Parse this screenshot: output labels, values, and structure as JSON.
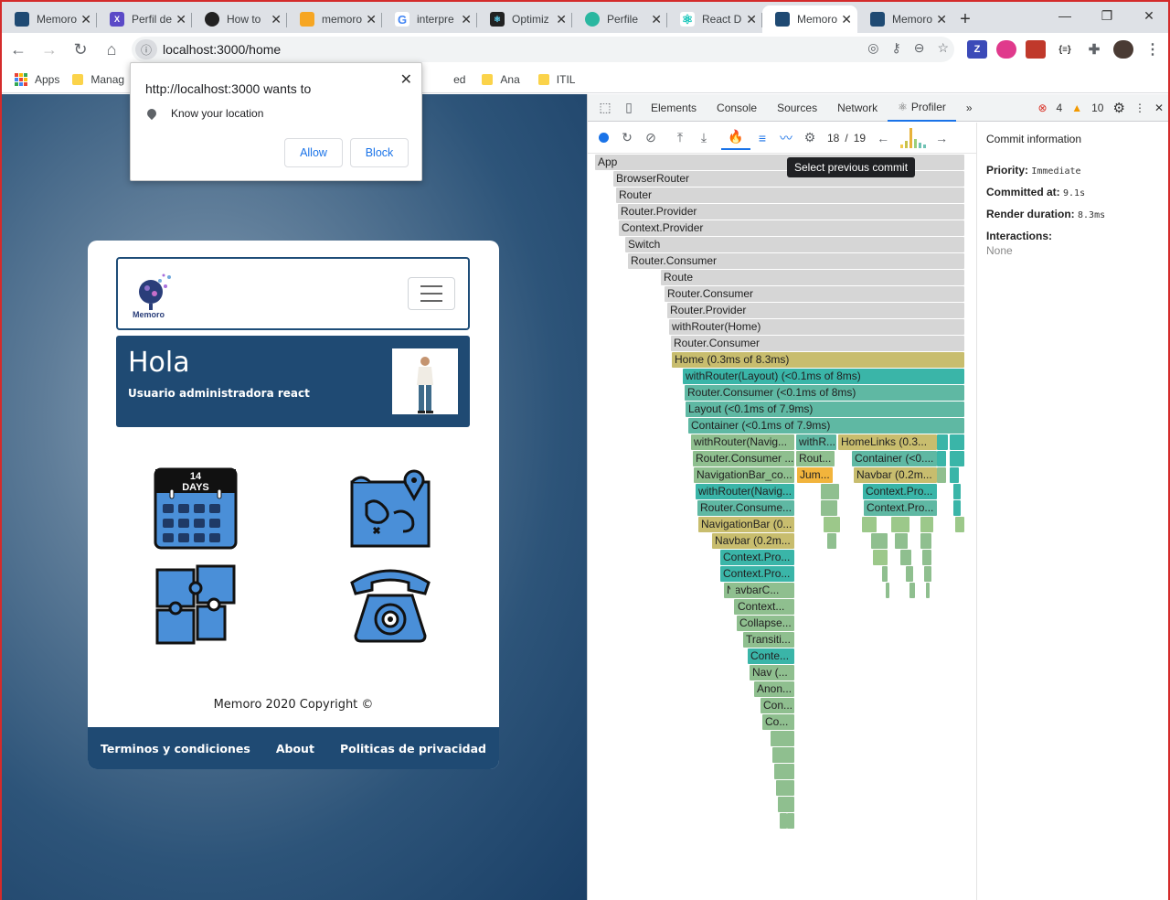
{
  "tabs": [
    {
      "title": "Memoro",
      "favicon": "memoro-icon",
      "color": "#1f4a73"
    },
    {
      "title": "Perfil de",
      "favicon": "xcd-icon",
      "color": "#5b4ac7"
    },
    {
      "title": "How to",
      "favicon": "github-icon",
      "color": "#222"
    },
    {
      "title": "memoro",
      "favicon": "firebase-icon",
      "color": "#f6a623"
    },
    {
      "title": "interpre",
      "favicon": "google-icon",
      "color": "#4285f4"
    },
    {
      "title": "Optimiz",
      "favicon": "react-icon",
      "color": "#222"
    },
    {
      "title": "Perfile",
      "favicon": "edge-icon",
      "color": "#2ab7a0"
    },
    {
      "title": "React D",
      "favicon": "react-icon",
      "color": "#11c4b8"
    },
    {
      "title": "Memoro",
      "favicon": "memoro-icon",
      "color": "#1f4a73",
      "active": true
    },
    {
      "title": "Memoro",
      "favicon": "memoro-icon",
      "color": "#1f4a73"
    }
  ],
  "address": {
    "url": "localhost:3000/home"
  },
  "bookmarks": {
    "apps": "Apps",
    "items": [
      "Manag",
      "ed",
      "Ana",
      "ITIL"
    ]
  },
  "permission": {
    "origin": "http://localhost:3000 wants to",
    "request": "Know your location",
    "allow": "Allow",
    "block": "Block"
  },
  "site": {
    "logo_text": "Memoro",
    "greeting": "Hola",
    "user": "Usuario administradora react",
    "calendar_number": "14",
    "calendar_label": "DAYS",
    "copyright": "Memoro 2020 Copyright ©",
    "footer_links": [
      "Terminos y condiciones",
      "About",
      "Politicas de privacidad"
    ]
  },
  "devtools": {
    "tabs": [
      "Elements",
      "Console",
      "Sources",
      "Network",
      "Profiler"
    ],
    "active_tab": "Profiler",
    "errors": "4",
    "warnings": "10",
    "commit_index": "18",
    "commit_sep": "/",
    "commit_total": "19",
    "tooltip": "Select previous commit",
    "commit_info": {
      "title": "Commit information",
      "priority_label": "Priority:",
      "priority": "Immediate",
      "committed_label": "Committed at:",
      "committed": "9.1s",
      "render_label": "Render duration:",
      "render": "8.3ms",
      "interactions_label": "Interactions:",
      "interactions": "None"
    },
    "flame_labels": [
      "App",
      "BrowserRouter",
      "Router",
      "Router.Provider",
      "Context.Provider",
      "Switch",
      "Router.Consumer",
      "Route",
      "Router.Consumer",
      "Router.Provider",
      "withRouter(Home)",
      "Router.Consumer",
      "Home (0.3ms of 8.3ms)",
      "withRouter(Layout) (<0.1ms of 8ms)",
      "Router.Consumer (<0.1ms of 8ms)",
      "Layout (<0.1ms of 7.9ms)",
      "Container (<0.1ms of 7.9ms)",
      "withRouter(Navig...",
      "withR...",
      "HomeLinks (0.3...",
      "Router.Consumer ...",
      "Rout...",
      "Container (<0....",
      "NavigationBar_co...",
      "Jum...",
      "Navbar (0.2m...",
      "withRouter(Navig...",
      "Context.Pro...",
      "Router.Consume...",
      "Context.Pro...",
      "NavigationBar (0...",
      "Navbar (0.2m...",
      "Context.Pro...",
      "Context.Pro...",
      "NavbarC...",
      "Context...",
      "Collapse...",
      "Transiti...",
      "Conte...",
      "Nav (...",
      "Anon...",
      "Con...",
      "Co..."
    ]
  }
}
